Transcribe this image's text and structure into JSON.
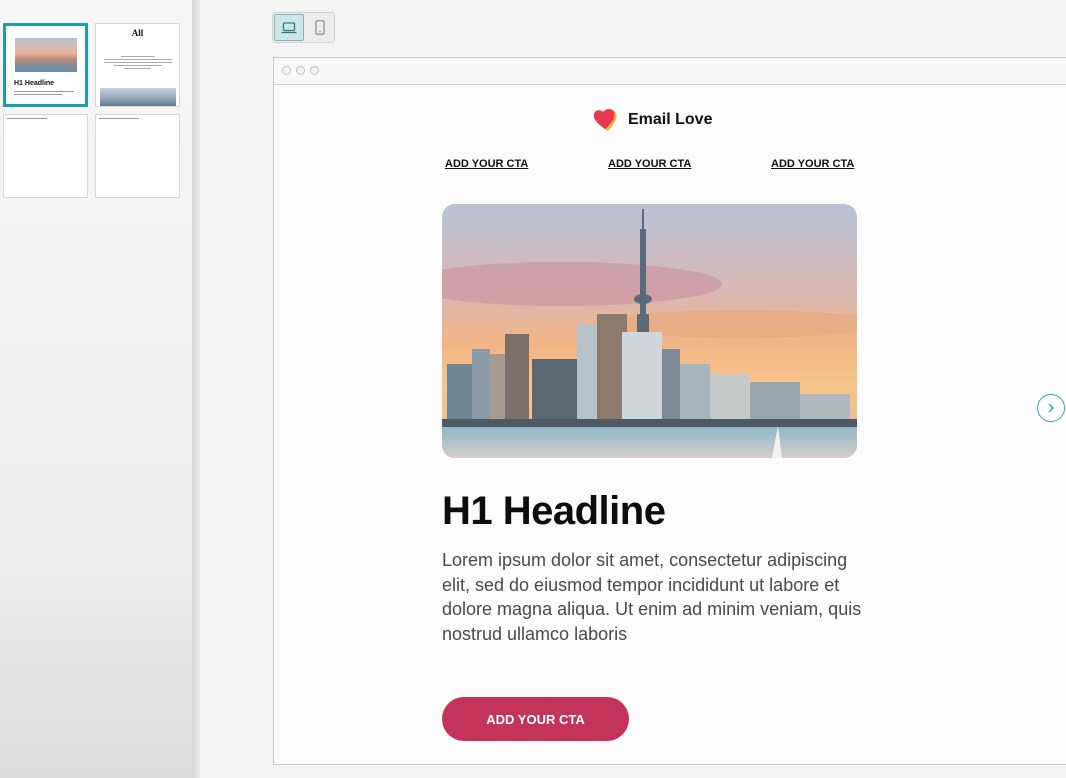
{
  "thumbnails": {
    "thumb1": {
      "headline": "H1 Headline"
    },
    "thumb2": {
      "logo": "All"
    }
  },
  "toolbar": {
    "desktop_icon": "laptop-icon",
    "mobile_icon": "phone-icon"
  },
  "email": {
    "logo_text": "Email Love",
    "nav": [
      "ADD YOUR CTA",
      "ADD YOUR CTA",
      "ADD YOUR CTA"
    ],
    "headline": "H1 Headline",
    "body": "Lorem ipsum dolor sit amet, consectetur adipiscing elit, sed do eiusmod tempor incididunt ut labore et dolore magna aliqua. Ut enim ad minim veniam, quis nostrud ullamco laboris",
    "cta_label": "ADD YOUR CTA"
  },
  "colors": {
    "accent": "#1c9ea6",
    "cta": "#c4345a",
    "heart_red": "#e8384f",
    "heart_yellow": "#f2b33d"
  }
}
